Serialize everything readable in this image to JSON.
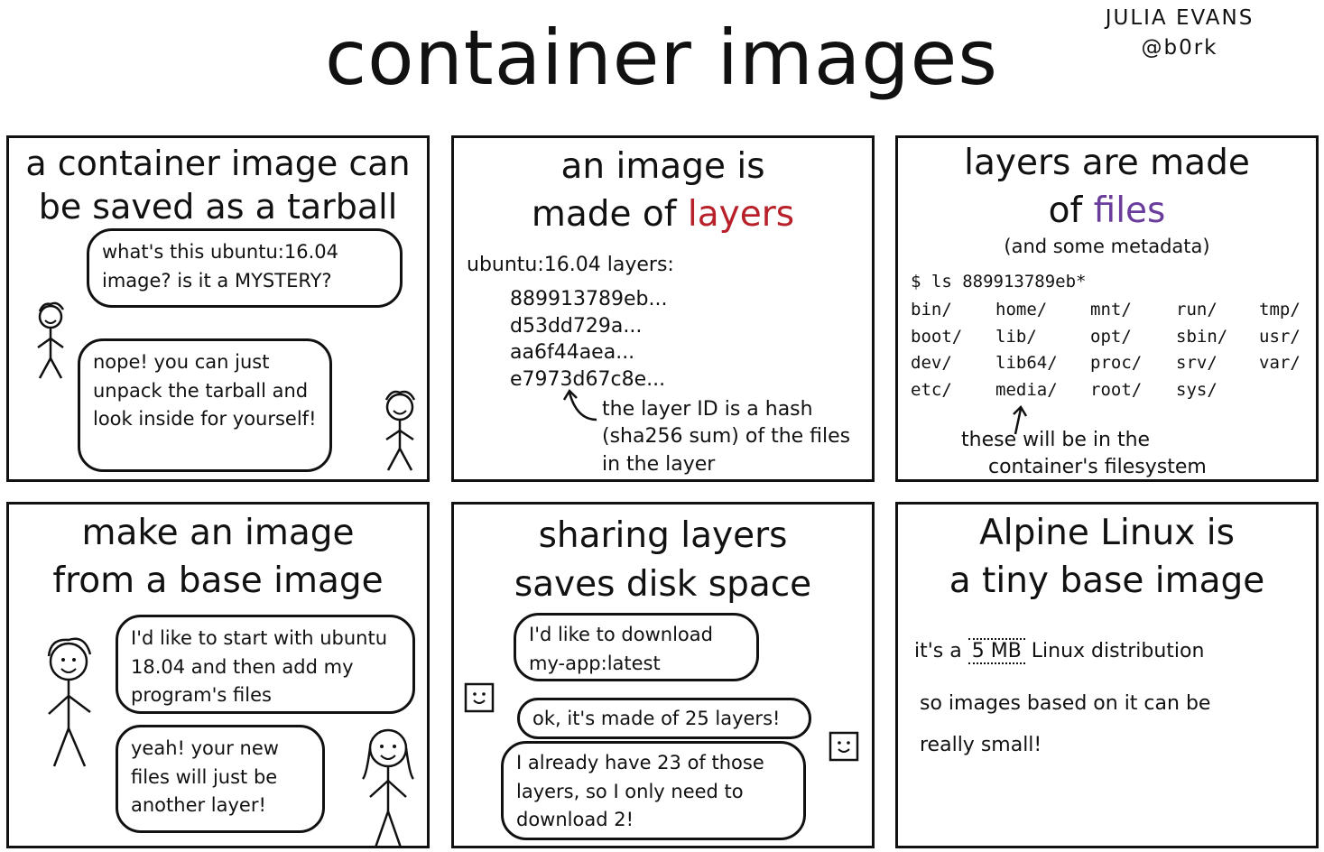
{
  "header": {
    "title": "container images",
    "author_name": "JULIA EVANS",
    "author_handle": "@b0rk"
  },
  "panels": {
    "tarball": {
      "title_line1": "a container image can",
      "title_line2": "be saved as a tarball",
      "bubble1": "what's this ubuntu:16.04 image? is it a MYSTERY?",
      "bubble2": "nope! you can just unpack the tarball and look inside for yourself!"
    },
    "layers": {
      "title_line1": "an image is",
      "title_prefix": "made of ",
      "title_highlight": "layers",
      "list_heading": "ubuntu:16.04 layers:",
      "layer_ids": [
        "889913789eb...",
        "d53dd729a...",
        "aa6f44aea...",
        "e7973d67c8e..."
      ],
      "annotation_line1": "the layer ID is a hash",
      "annotation_line2": "(sha256 sum) of the files",
      "annotation_line3": "in the layer",
      "highlight_color": "#b8212a"
    },
    "files": {
      "title_line1": "layers are made",
      "title_prefix": "of ",
      "title_highlight": "files",
      "subtitle": "(and some metadata)",
      "command": "$ ls 889913789eb*",
      "dir_columns": [
        [
          "bin/",
          "boot/",
          "dev/",
          "etc/"
        ],
        [
          "home/",
          "lib/",
          "lib64/",
          "media/"
        ],
        [
          "mnt/",
          "opt/",
          "proc/",
          "root/"
        ],
        [
          "run/",
          "sbin/",
          "srv/",
          "sys/"
        ],
        [
          "tmp/",
          "usr/",
          "var/"
        ]
      ],
      "annotation_line1": "these will be in the",
      "annotation_line2": "container's filesystem",
      "highlight_color": "#6a3c9b"
    },
    "base_image": {
      "title_line1": "make an image",
      "title_line2": "from a base image",
      "bubble1": "I'd like to start with ubuntu 18.04 and then add my program's files",
      "bubble2": "yeah! your new files will just be another layer!"
    },
    "sharing": {
      "title_line1": "sharing layers",
      "title_line2": "saves disk space",
      "bubble1": "I'd like to download my-app:latest",
      "bubble2": "ok, it's made of 25 layers!",
      "bubble3": "I already have 23 of those layers, so I only need to download 2!"
    },
    "alpine": {
      "title_line1": "Alpine Linux is",
      "title_line2": "a tiny base image",
      "line1_prefix": "it's a ",
      "line1_size": "5 MB",
      "line1_suffix": " Linux distribution",
      "line2": "so images based on it can be",
      "line3": "really small!"
    }
  }
}
